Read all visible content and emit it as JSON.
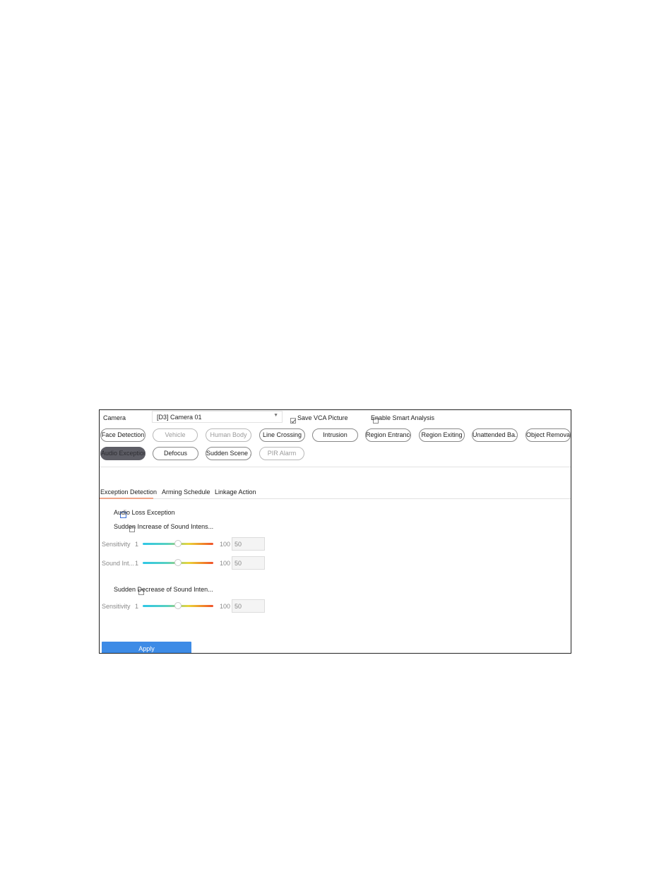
{
  "camera": {
    "label": "Camera",
    "selected": "[D3] Camera 01",
    "save_vca_label": "Save VCA Picture",
    "save_vca_checked": true,
    "smart_analysis_label": "Enable Smart Analysis",
    "smart_analysis_checked": false
  },
  "functions": [
    {
      "label": "Face Detection",
      "state": "normal"
    },
    {
      "label": "Vehicle",
      "state": "disabled"
    },
    {
      "label": "Human Body",
      "state": "disabled"
    },
    {
      "label": "Line Crossing",
      "state": "normal"
    },
    {
      "label": "Intrusion",
      "state": "normal"
    },
    {
      "label": "Region Entrance",
      "state": "normal"
    },
    {
      "label": "Region Exiting",
      "state": "normal"
    },
    {
      "label": "Unattended Ba...",
      "state": "normal"
    },
    {
      "label": "Object Removal",
      "state": "normal"
    },
    {
      "label": "Audio Exception",
      "state": "active"
    },
    {
      "label": "Defocus",
      "state": "normal"
    },
    {
      "label": "Sudden Scene ...",
      "state": "normal"
    },
    {
      "label": "PIR Alarm",
      "state": "disabled"
    }
  ],
  "tabs": [
    {
      "label": "Exception Detection",
      "active": true
    },
    {
      "label": "Arming Schedule",
      "active": false
    },
    {
      "label": "Linkage Action",
      "active": false
    }
  ],
  "exceptions": {
    "audio_loss": {
      "label": "Audio Loss Exception",
      "checked": false
    },
    "sudden_increase": {
      "label": "Sudden Increase of Sound Intens...",
      "checked": false,
      "sensitivity": {
        "label": "Sensitivity",
        "min": "1",
        "max": "100",
        "value": "50"
      },
      "sound_intensity": {
        "label": "Sound Int...",
        "min": "1",
        "max": "100",
        "value": "50"
      }
    },
    "sudden_decrease": {
      "label": "Sudden Decrease of Sound Inten...",
      "checked": false,
      "sensitivity": {
        "label": "Sensitivity",
        "min": "1",
        "max": "100",
        "value": "50"
      }
    }
  },
  "apply_label": "Apply",
  "colors": {
    "accent_blue": "#3d8be6",
    "active_pill": "#5e5e66",
    "tab_underline": "#f0a58a"
  }
}
